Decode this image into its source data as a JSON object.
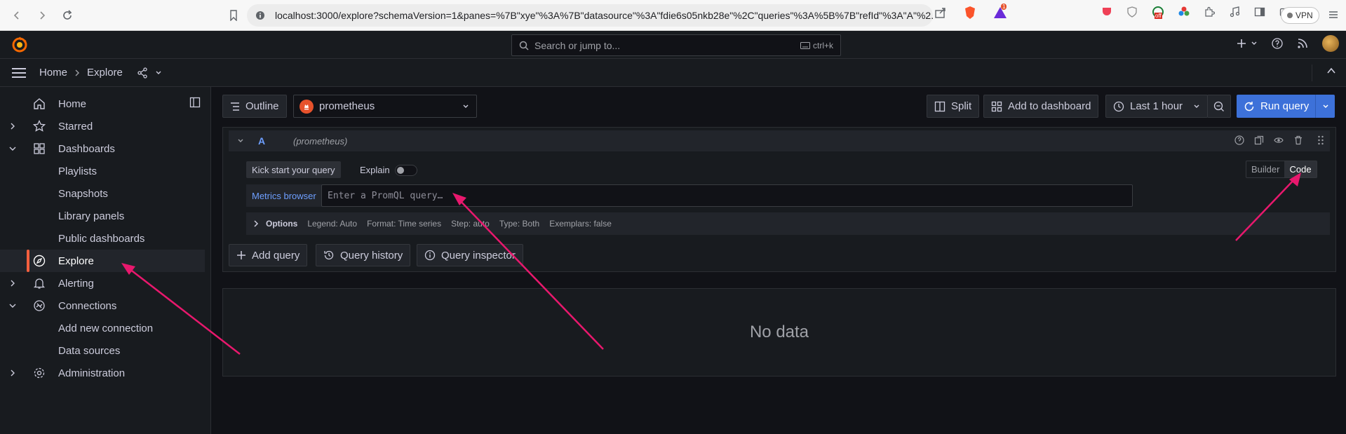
{
  "browser": {
    "url": "localhost:3000/explore?schemaVersion=1&panes=%7B\"xye\"%3A%7B\"datasource\"%3A\"fdie6s05nkb28e\"%2C\"queries\"%3A%5B%7B\"refId\"%3A\"A\"%2...",
    "vpn_label": "VPN",
    "badge_count": "1",
    "ext_badge": "off"
  },
  "topnav": {
    "search_placeholder": "Search or jump to...",
    "search_shortcut": "ctrl+k"
  },
  "breadcrumb": {
    "home": "Home",
    "current": "Explore"
  },
  "sidebar": {
    "items": [
      {
        "label": "Home",
        "icon": "home-icon"
      },
      {
        "label": "Starred",
        "icon": "star-icon"
      },
      {
        "label": "Dashboards",
        "icon": "apps-icon"
      },
      {
        "label": "Playlists"
      },
      {
        "label": "Snapshots"
      },
      {
        "label": "Library panels"
      },
      {
        "label": "Public dashboards"
      },
      {
        "label": "Explore",
        "icon": "compass-icon",
        "active": true
      },
      {
        "label": "Alerting",
        "icon": "bell-icon"
      },
      {
        "label": "Connections",
        "icon": "connections-icon"
      },
      {
        "label": "Add new connection"
      },
      {
        "label": "Data sources"
      },
      {
        "label": "Administration",
        "icon": "cog-icon"
      }
    ]
  },
  "toolbar": {
    "outline": "Outline",
    "datasource": "prometheus",
    "split": "Split",
    "add_to_dashboard": "Add to dashboard",
    "time_range": "Last 1 hour",
    "run_query": "Run query"
  },
  "query": {
    "letter": "A",
    "datasource_hint": "(prometheus)",
    "kick_start": "Kick start your query",
    "explain": "Explain",
    "builder": "Builder",
    "code": "Code",
    "metrics_browser": "Metrics browser",
    "placeholder": "Enter a PromQL query…",
    "options": {
      "title": "Options",
      "legend": "Legend: Auto",
      "format": "Format: Time series",
      "step": "Step: auto",
      "type": "Type: Both",
      "exemplars": "Exemplars: false"
    }
  },
  "actions": {
    "add_query": "Add query",
    "query_history": "Query history",
    "query_inspector": "Query inspector"
  },
  "results": {
    "empty": "No data"
  },
  "colors": {
    "accent": "#3d71d9",
    "active_marker": "#f55f3e",
    "annotation": "#e8186d"
  }
}
